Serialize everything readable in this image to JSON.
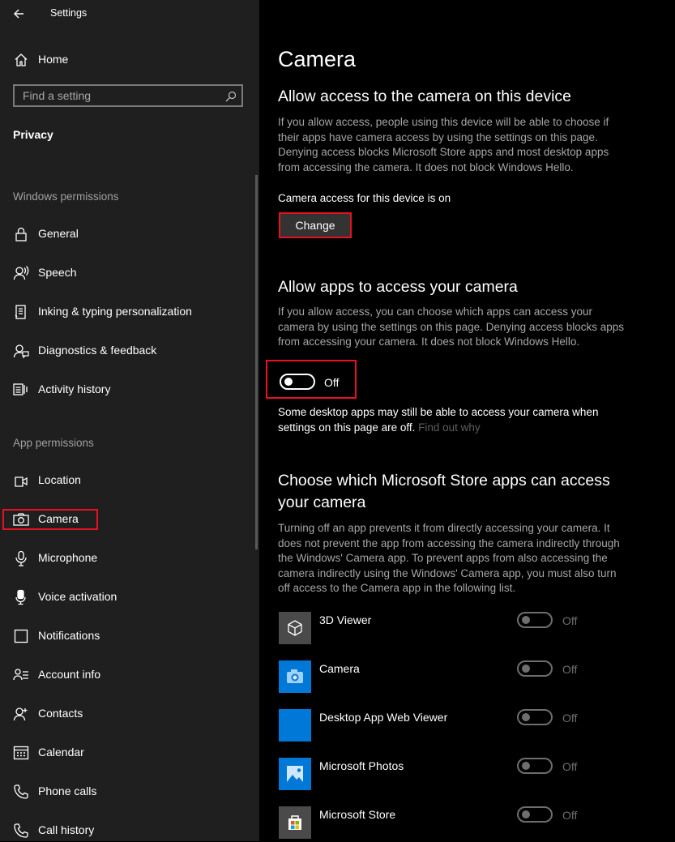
{
  "window": {
    "title": "Settings"
  },
  "sidebar": {
    "home_label": "Home",
    "search_placeholder": "Find a setting",
    "section_title": "Privacy",
    "windows_permissions_header": "Windows permissions",
    "windows_permissions": [
      {
        "label": "General",
        "icon": "lock-icon"
      },
      {
        "label": "Speech",
        "icon": "speech-icon"
      },
      {
        "label": "Inking & typing personalization",
        "icon": "inking-icon"
      },
      {
        "label": "Diagnostics & feedback",
        "icon": "feedback-icon"
      },
      {
        "label": "Activity history",
        "icon": "activity-history-icon"
      }
    ],
    "app_permissions_header": "App permissions",
    "app_permissions": [
      {
        "label": "Location",
        "icon": "location-icon"
      },
      {
        "label": "Camera",
        "icon": "camera-icon",
        "selected": true
      },
      {
        "label": "Microphone",
        "icon": "microphone-icon"
      },
      {
        "label": "Voice activation",
        "icon": "voice-activation-icon"
      },
      {
        "label": "Notifications",
        "icon": "notifications-icon"
      },
      {
        "label": "Account info",
        "icon": "account-info-icon"
      },
      {
        "label": "Contacts",
        "icon": "contacts-icon"
      },
      {
        "label": "Calendar",
        "icon": "calendar-icon"
      },
      {
        "label": "Phone calls",
        "icon": "phone-icon"
      },
      {
        "label": "Call history",
        "icon": "call-history-icon"
      }
    ]
  },
  "main": {
    "page_title": "Camera",
    "device_access": {
      "heading": "Allow access to the camera on this device",
      "description": "If you allow access, people using this device will be able to choose if their apps have camera access by using the settings on this page. Denying access blocks Microsoft Store apps and most desktop apps from accessing the camera. It does not block Windows Hello.",
      "status": "Camera access for this device is on",
      "change_button": "Change"
    },
    "apps_access": {
      "heading": "Allow apps to access your camera",
      "description": "If you allow access, you can choose which apps can access your camera by using the settings on this page. Denying access blocks apps from accessing your camera. It does not block Windows Hello.",
      "toggle_state": "Off",
      "note": "Some desktop apps may still be able to access your camera when settings on this page are off.",
      "note_link": "Find out why"
    },
    "store_apps": {
      "heading": "Choose which Microsoft Store apps can access your camera",
      "description": "Turning off an app prevents it from directly accessing your camera. It does not prevent the app from accessing the camera indirectly through the Windows' Camera app. To prevent apps from also accessing the camera indirectly using the Windows' Camera app, you must also turn off access to the Camera app in the following list.",
      "apps": [
        {
          "name": "3D Viewer",
          "state": "Off",
          "icon": "3d-viewer-icon",
          "tile_color": "#4a4a4a"
        },
        {
          "name": "Camera",
          "state": "Off",
          "icon": "camera-app-icon",
          "tile_color": "#0078d7"
        },
        {
          "name": "Desktop App Web Viewer",
          "state": "Off",
          "icon": "web-viewer-icon",
          "tile_color": "#0078d7"
        },
        {
          "name": "Microsoft Photos",
          "state": "Off",
          "icon": "photos-icon",
          "tile_color": "#0078d7"
        },
        {
          "name": "Microsoft Store",
          "state": "Off",
          "icon": "store-icon",
          "tile_color": "#4a4a4a"
        }
      ]
    }
  },
  "colors": {
    "accent_highlight": "#e81123",
    "sidebar_bg": "#1f1f1f",
    "main_bg": "#000000",
    "tile_blue": "#0078d7",
    "muted_text": "#a6a6a6"
  }
}
